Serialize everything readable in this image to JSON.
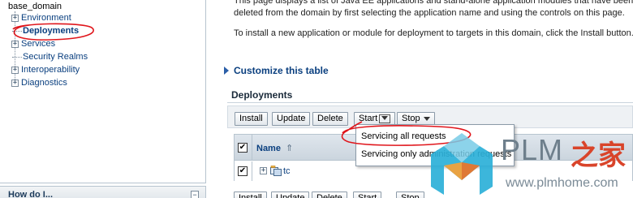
{
  "tree": {
    "root": "base_domain",
    "items": [
      {
        "label": "Environment",
        "type": "expand"
      },
      {
        "label": "Deployments",
        "type": "leaf",
        "selected": true
      },
      {
        "label": "Services",
        "type": "expand"
      },
      {
        "label": "Security Realms",
        "type": "leaf"
      },
      {
        "label": "Interoperability",
        "type": "expand"
      },
      {
        "label": "Diagnostics",
        "type": "expand"
      }
    ],
    "expand_symbol": "+"
  },
  "howdo": {
    "title": "How do I...",
    "collapse_symbol": "−"
  },
  "description": {
    "line1": "This page displays a list of Java EE applications and stand-alone application modules that have been ins",
    "line2": "deleted from the domain by first selecting the application name and using the controls on this page.",
    "line3": "To install a new application or module for deployment to targets in this domain, click the Install button."
  },
  "customize_link": "Customize this table",
  "section_title": "Deployments",
  "toolbar": {
    "install": "Install",
    "update": "Update",
    "delete": "Delete",
    "start": "Start",
    "stop": "Stop"
  },
  "table": {
    "name_header": "Name",
    "sort_symbol": "⇑",
    "check_symbol": "✔",
    "row_expand_symbol": "+",
    "rows": [
      {
        "name": "tc",
        "checked": true
      }
    ]
  },
  "start_menu": {
    "items": [
      "Servicing all requests",
      "Servicing only administration requests"
    ]
  },
  "watermark": {
    "brand": "PLM",
    "brand_cn": "之家",
    "url": "www.plmhome.com"
  },
  "colors": {
    "link": "#0a3f7f",
    "annotation_red": "#e0161c",
    "watermark_red": "#d9442a"
  }
}
